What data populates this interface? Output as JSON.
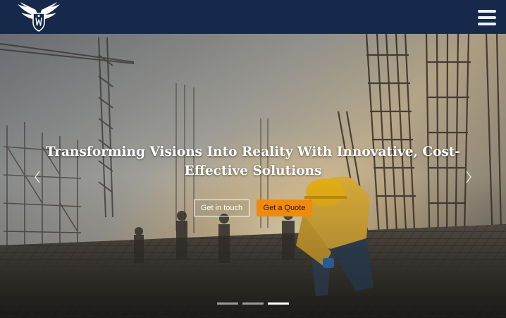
{
  "header": {
    "logo_name": "winged-shield-logo",
    "menu_icon": "hamburger-menu-icon"
  },
  "hero": {
    "headline": "Transforming Visions Into Reality With Innovative, Cost-Effective Solutions",
    "primary_button_label": "Get in touch",
    "secondary_button_label": "Get a Quote",
    "prev_icon": "chevron-left-icon",
    "next_icon": "chevron-right-icon",
    "slide_count": 3,
    "active_slide": 3
  },
  "colors": {
    "navbar": "#16294a",
    "accent_orange": "#f08a0c",
    "text_white": "#ffffff"
  }
}
